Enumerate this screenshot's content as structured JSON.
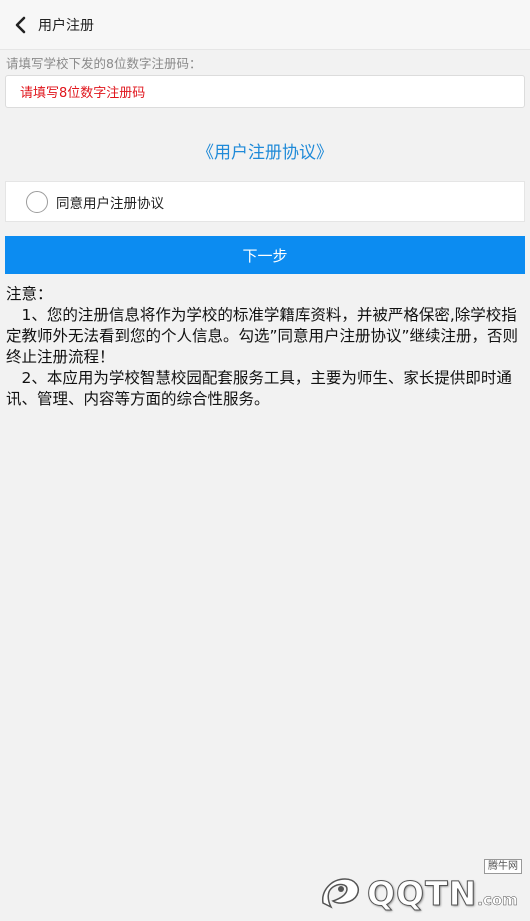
{
  "header": {
    "title": "用户注册"
  },
  "form": {
    "hint": "请填写学校下发的8位数字注册码：",
    "code_placeholder": "请填写8位数字注册码",
    "agreement_link": "《用户注册协议》",
    "agree_label": "同意用户注册协议",
    "agree_checked": false,
    "next_label": "下一步"
  },
  "notice": {
    "heading": "注意：",
    "item1": "　1、您的注册信息将作为学校的标准学籍库资料，并被严格保密,除学校指定教师外无法看到您的个人信息。勾选”同意用户注册协议”继续注册，否则终止注册流程！",
    "item2": "　2、本应用为学校智慧校园配套服务工具，主要为师生、家长提供即时通讯、管理、内容等方面的综合性服务。"
  },
  "watermark": {
    "text": "QQTN",
    "suffix": ".com",
    "badge": "腾牛网"
  },
  "colors": {
    "accent": "#0c8cf1",
    "link": "#1f8ad8",
    "placeholder": "#e0161d"
  }
}
